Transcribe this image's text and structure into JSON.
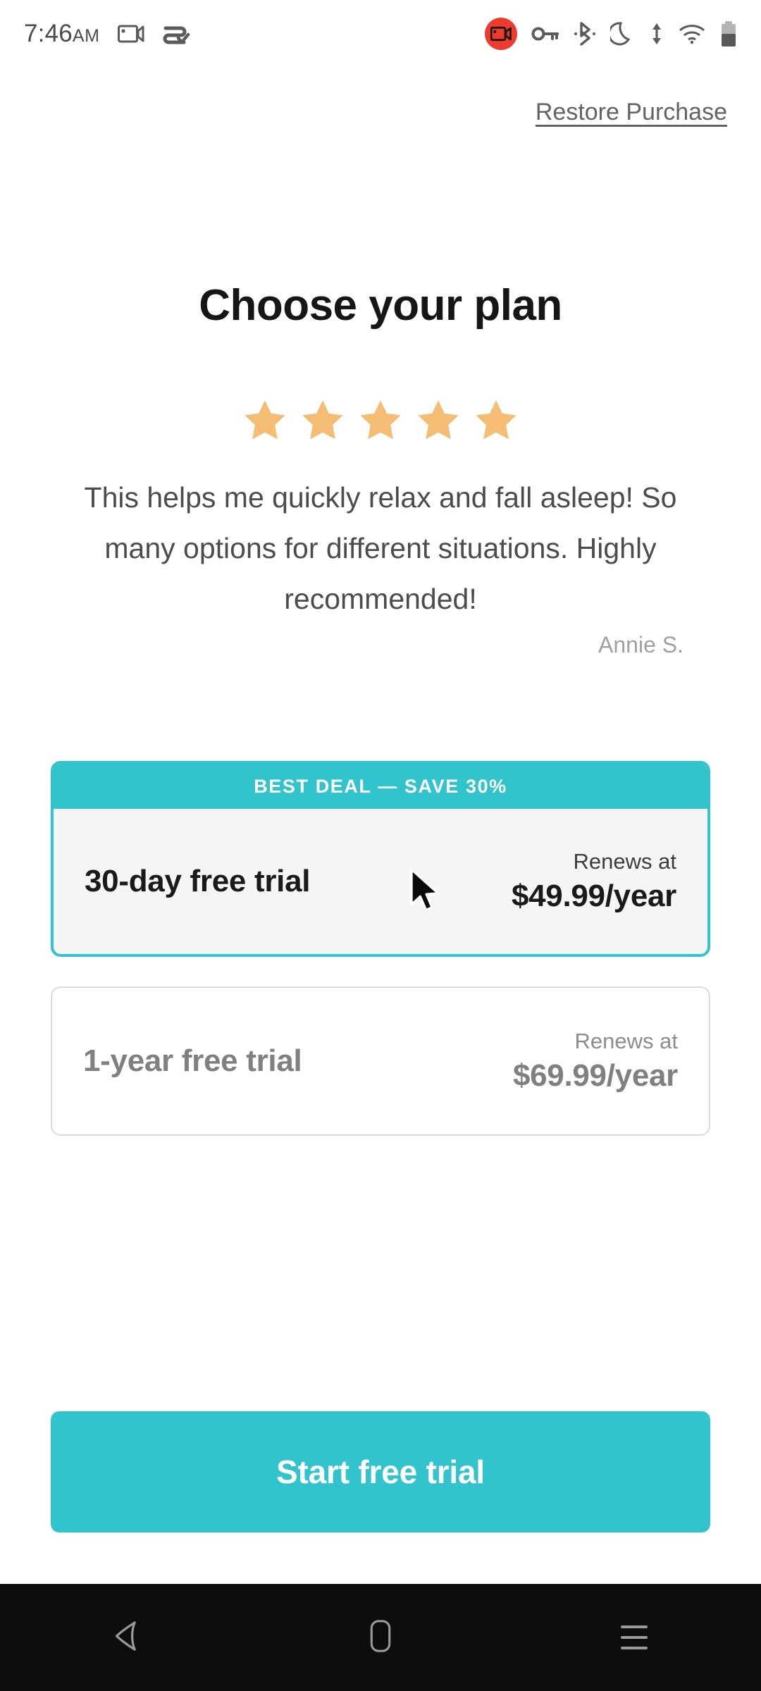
{
  "status_bar": {
    "time": "7:46",
    "ampm": "AM",
    "icons_left": [
      "screen-record-icon",
      "vpn-check-icon"
    ],
    "icons_right": [
      "screen-record-active-badge-icon",
      "key-icon",
      "bluetooth-icon",
      "do-not-disturb-moon-icon",
      "data-transfer-icon",
      "wifi-icon",
      "battery-icon"
    ],
    "record_badge_color": "#ee3b2e",
    "battery_level_percent": 50
  },
  "header": {
    "restore_purchase_label": "Restore Purchase"
  },
  "main": {
    "title": "Choose your plan",
    "rating": {
      "stars": 5,
      "star_color": "#f5bc74"
    },
    "review": {
      "quote": "This helps me quickly relax and fall asleep! So many options for different situations. Highly recommended!",
      "author": "Annie S."
    },
    "plans": [
      {
        "id": "plan-30-day",
        "banner": "BEST DEAL — SAVE 30%",
        "title": "30-day free trial",
        "renews_label": "Renews at",
        "price": "$49.99/year",
        "selected": true
      },
      {
        "id": "plan-1-year",
        "banner": "",
        "title": "1-year free trial",
        "renews_label": "Renews at",
        "price": "$69.99/year",
        "selected": false
      }
    ],
    "cta_label": "Start free trial"
  },
  "theme": {
    "accent": "#31c4cc",
    "star": "#f5bc74",
    "card_selected_bg": "#f5f5f5",
    "text_primary": "#1a1a1a",
    "text_muted": "#808080"
  },
  "nav_bar": {
    "items": [
      "back-icon",
      "home-icon",
      "recents-icon"
    ]
  }
}
